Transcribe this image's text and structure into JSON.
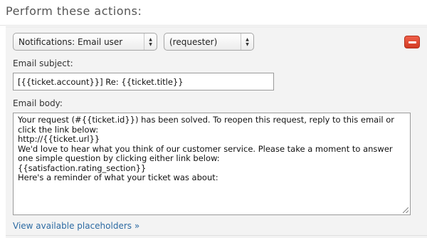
{
  "section": {
    "title": "Perform these actions:"
  },
  "action": {
    "action_select_value": "Notifications: Email user",
    "target_select_value": "(requester)",
    "remove_icon": "minus-icon",
    "remove_color": "#e04a32"
  },
  "email_subject": {
    "label": "Email subject:",
    "value": "[{{ticket.account}}] Re: {{ticket.title}}"
  },
  "email_body": {
    "label": "Email body:",
    "lines": [
      "Your request (#{{ticket.id}}) has been solved. To reopen this request, reply to this email or click the link below:",
      "http://{{ticket.url}}",
      "",
      "We'd love to hear what you think of our customer service. Please take a moment to answer one simple question by clicking either link below:",
      "",
      "{{satisfaction.rating_section}}",
      "",
      "Here's a reminder of what your ticket was about:"
    ]
  },
  "placeholders_link": {
    "label": "View available placeholders »",
    "color": "#2d6ba3"
  }
}
